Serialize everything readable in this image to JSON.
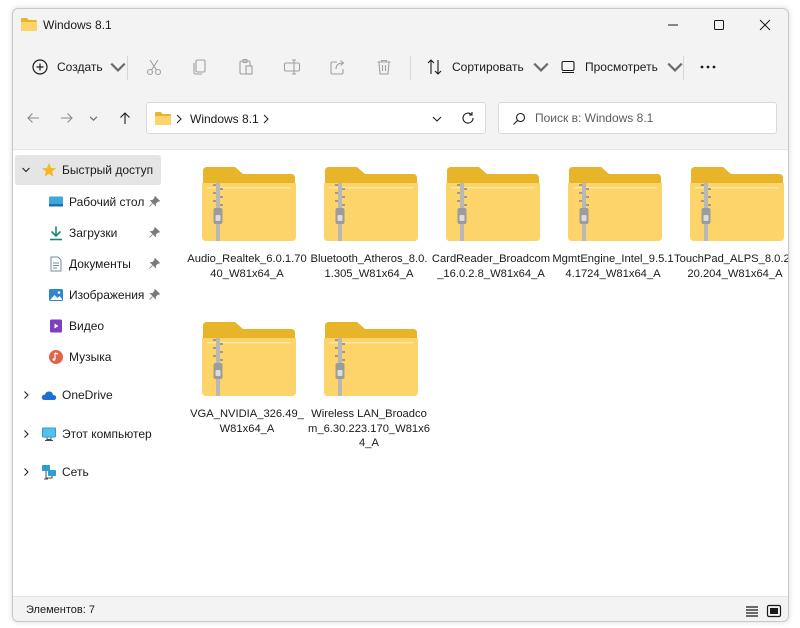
{
  "window": {
    "title": "Windows 8.1",
    "controls": [
      "minimize-icon",
      "maximize-icon",
      "close-icon"
    ]
  },
  "toolbar": {
    "create_label": "Создать",
    "sort_label": "Сортировать",
    "view_label": "Просмотреть",
    "disabled_actions": [
      "cut-icon",
      "copy-icon",
      "paste-icon",
      "rename-icon",
      "share-icon",
      "delete-icon"
    ]
  },
  "address": {
    "path": "Windows 8.1",
    "search_placeholder": "Поиск в: Windows 8.1"
  },
  "sidebar": {
    "quick_access": "Быстрый доступ",
    "items": [
      {
        "label": "Рабочий стол",
        "icon": "desktop-icon",
        "pinned": true
      },
      {
        "label": "Загрузки",
        "icon": "download-icon",
        "pinned": true
      },
      {
        "label": "Документы",
        "icon": "document-icon",
        "pinned": true
      },
      {
        "label": "Изображения",
        "icon": "pictures-icon",
        "pinned": true
      },
      {
        "label": "Видео",
        "icon": "video-icon",
        "pinned": false
      },
      {
        "label": "Музыка",
        "icon": "music-icon",
        "pinned": false
      }
    ],
    "onedrive": "OneDrive",
    "this_pc": "Этот компьютер",
    "network": "Сеть"
  },
  "files": [
    {
      "name": "Audio_Realtek_6.0.1.7040_W81x64_A",
      "icon": "zip-folder-icon"
    },
    {
      "name": "Bluetooth_Atheros_8.0.1.305_W81x64_A",
      "icon": "zip-folder-icon"
    },
    {
      "name": "CardReader_Broadcom_16.0.2.8_W81x64_A",
      "icon": "zip-folder-icon"
    },
    {
      "name": "MgmtEngine_Intel_9.5.14.1724_W81x64_A",
      "icon": "zip-folder-icon"
    },
    {
      "name": "TouchPad_ALPS_8.0.2020.204_W81x64_A",
      "icon": "zip-folder-icon"
    },
    {
      "name": "VGA_NVIDIA_326.49_W81x64_A",
      "icon": "zip-folder-icon"
    },
    {
      "name": "Wireless LAN_Broadcom_6.30.223.170_W81x64_A",
      "icon": "zip-folder-icon"
    }
  ],
  "status": {
    "items_count": "Элементов: 7"
  },
  "colors": {
    "folder_back": "#e8b429",
    "folder_front": "#fcd46a",
    "zipper": "#9a9a9a",
    "accent_blue": "#2b7ad6"
  }
}
